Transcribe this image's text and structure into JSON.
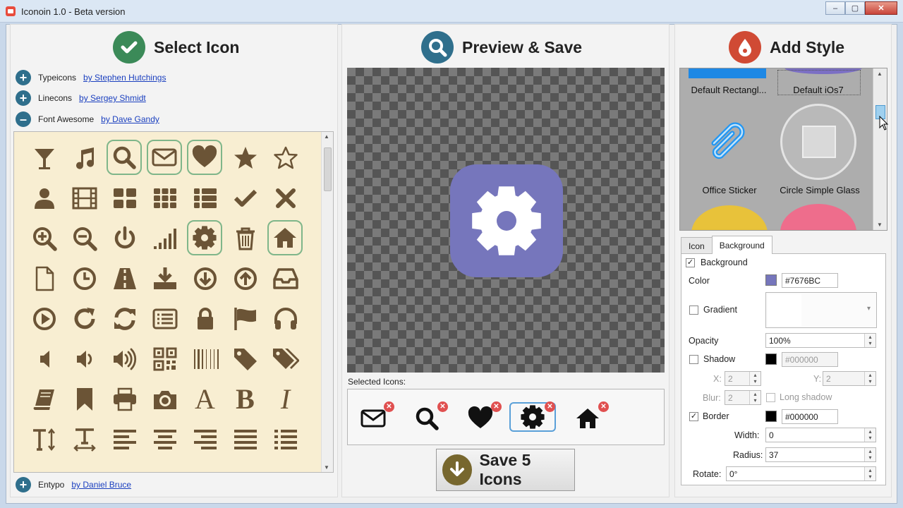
{
  "window": {
    "title": "Iconoin 1.0 - Beta version",
    "min": "–",
    "max": "▢",
    "close": "✕"
  },
  "select": {
    "title": "Select Icon",
    "sets": [
      {
        "expander": "+",
        "name": "Typeicons",
        "author": "by Stephen Hutchings"
      },
      {
        "expander": "+",
        "name": "Linecons",
        "author": "by Sergey Shmidt"
      },
      {
        "expander": "–",
        "name": "Font Awesome",
        "author": "by Dave Gandy"
      },
      {
        "expander": "+",
        "name": "Entypo",
        "author": "by Daniel Bruce"
      }
    ],
    "icons": [
      "glass-icon",
      "music-icon",
      "search-icon",
      "envelope-icon",
      "heart-icon",
      "star-icon",
      "star-outline-icon",
      "user-icon",
      "film-icon",
      "th-large-icon",
      "th-icon",
      "th-list-icon",
      "check-icon",
      "times-icon",
      "zoom-in-icon",
      "zoom-out-icon",
      "power-icon",
      "signal-icon",
      "cog-icon",
      "trash-icon",
      "home-icon",
      "file-icon",
      "clock-icon",
      "road-icon",
      "download-icon",
      "arrow-circle-down-icon",
      "arrow-circle-up-icon",
      "inbox-icon",
      "play-circle-icon",
      "repeat-icon",
      "refresh-icon",
      "list-alt-icon",
      "lock-icon",
      "flag-icon",
      "headphones-icon",
      "volume-off-icon",
      "volume-down-icon",
      "volume-up-icon",
      "qrcode-icon",
      "barcode-icon",
      "tag-icon",
      "tags-icon",
      "book-icon",
      "bookmark-icon",
      "print-icon",
      "camera-icon",
      "font-icon",
      "bold-icon",
      "italic-icon",
      "text-height-icon",
      "text-width-icon",
      "align-left-icon",
      "align-center-icon",
      "align-right-icon",
      "align-justify-icon",
      "list-icon"
    ],
    "selected_icons": [
      "search-icon",
      "envelope-icon",
      "heart-icon",
      "cog-icon",
      "home-icon"
    ],
    "glyphs": {
      "font-icon": "A",
      "bold-icon": "B",
      "italic-icon": "I"
    }
  },
  "preview": {
    "title": "Preview & Save",
    "selected_label": "Selected Icons:",
    "selected": [
      "envelope-icon",
      "search-icon",
      "heart-icon",
      "cog-icon",
      "home-icon"
    ],
    "remove_glyph": "✕",
    "save_label": "Save 5 Icons"
  },
  "style": {
    "title": "Add Style",
    "gallery": [
      "Default Rectangl...",
      "Default iOs7",
      "Office Sticker",
      "Circle Simple Glass"
    ],
    "tabs": [
      "Icon",
      "Background"
    ],
    "active_tab": "Background",
    "background_label": "Background",
    "background_checked": "✓",
    "color_label": "Color",
    "color_value": "#7676BC",
    "gradient_label": "Gradient",
    "opacity_label": "Opacity",
    "opacity_value": "100%",
    "shadow_label": "Shadow",
    "shadow_color": "#000000",
    "x_label": "X:",
    "x_value": "2",
    "y_label": "Y:",
    "y_value": "2",
    "blur_label": "Blur:",
    "blur_value": "2",
    "long_shadow_label": "Long shadow",
    "border_label": "Border",
    "border_checked": "✓",
    "border_color": "#000000",
    "width_label": "Width:",
    "width_value": "0",
    "radius_label": "Radius:",
    "radius_value": "37",
    "rotate_label": "Rotate:",
    "rotate_value": "0°"
  },
  "colors": {
    "accent_bg": "#7676BC",
    "icon_brown": "#6b5436",
    "grid_bg": "#f8eed2",
    "select_green": "#7fb68a"
  }
}
